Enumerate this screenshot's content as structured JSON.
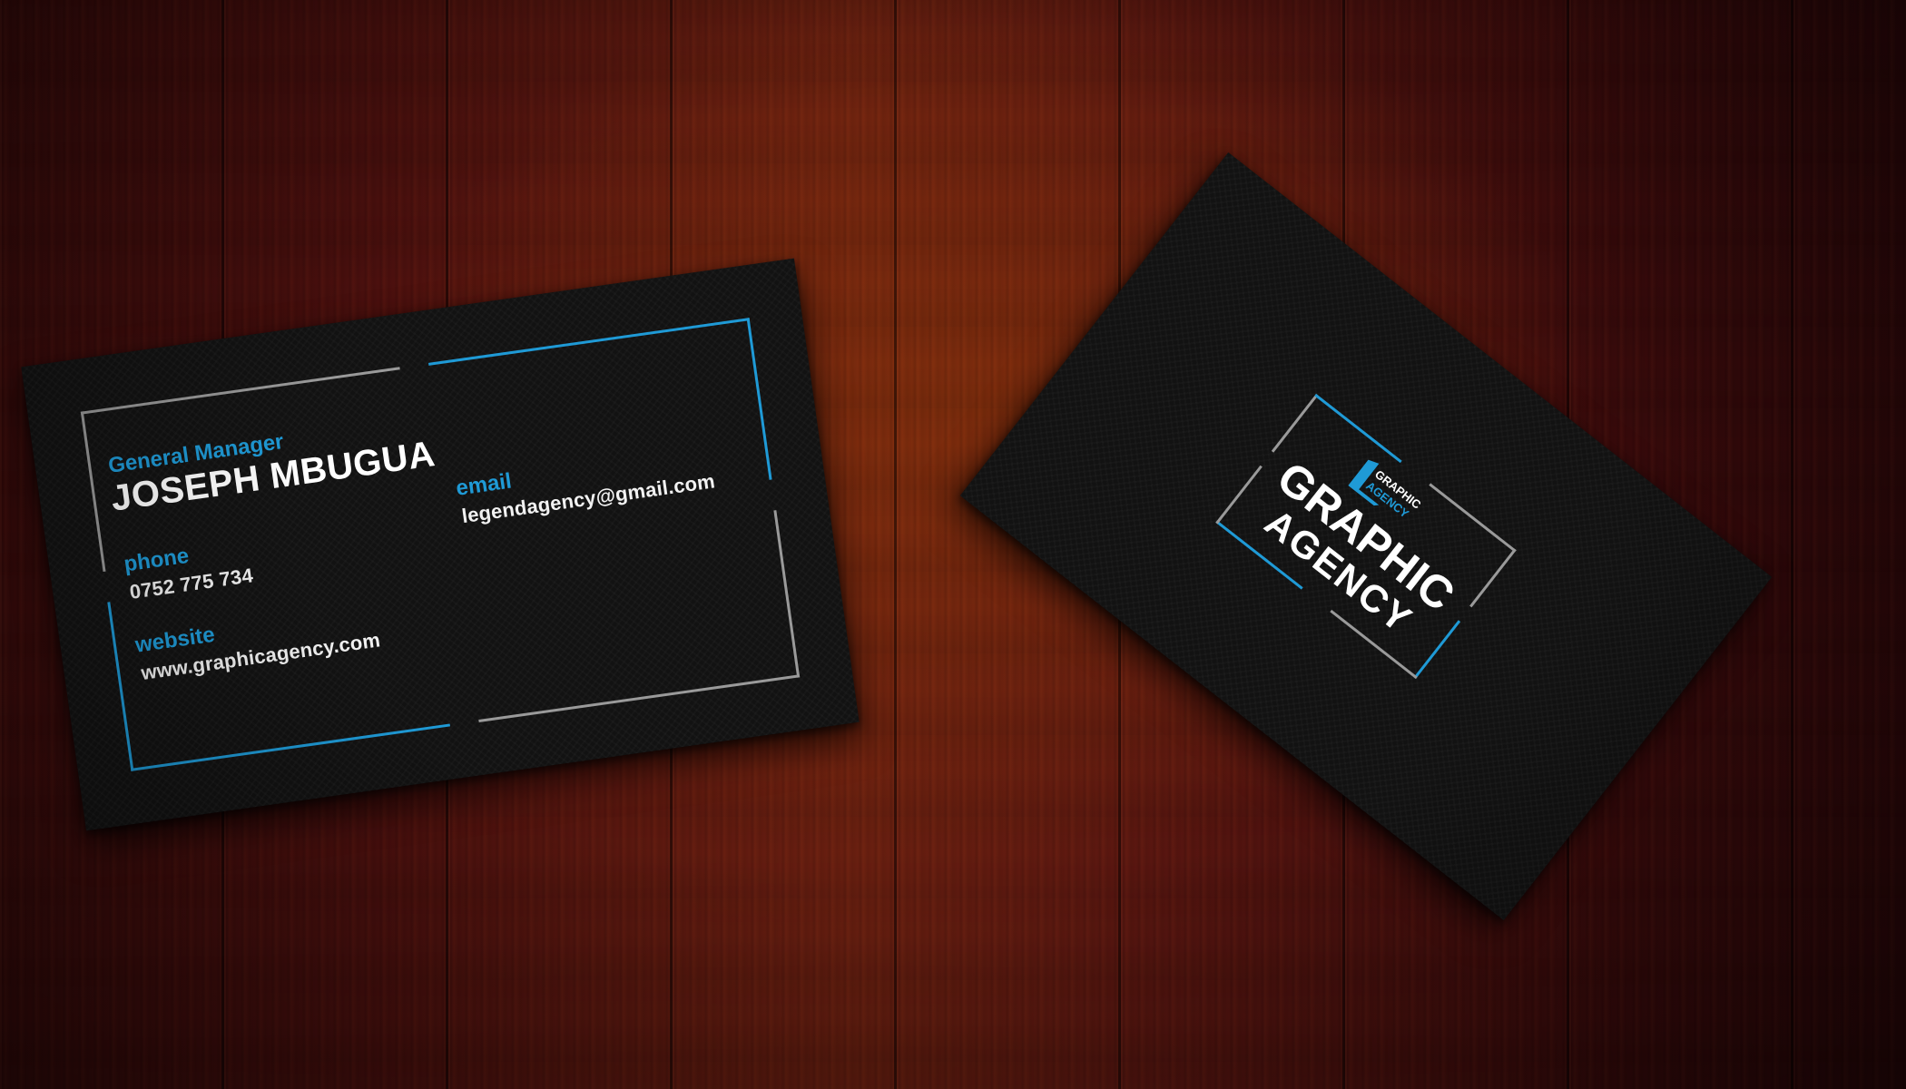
{
  "back_card": {
    "title": "General Manager",
    "name": "JOSEPH MBUGUA",
    "phone_label": "phone",
    "phone": "0752 775 734",
    "website_label": "website",
    "website": "www.graphicagency.com",
    "email_label": "email",
    "email": "legendagency@gmail.com"
  },
  "front_card": {
    "brand_line1": "GRAPHIC",
    "brand_line2": "AGENCY",
    "logo_line1": "GRAPHIC",
    "logo_line2": "AGENCY"
  },
  "colors": {
    "accent": "#1f9ad6",
    "card": "#121212",
    "frame_gray": "#9a9a9a",
    "text": "#ffffff"
  }
}
